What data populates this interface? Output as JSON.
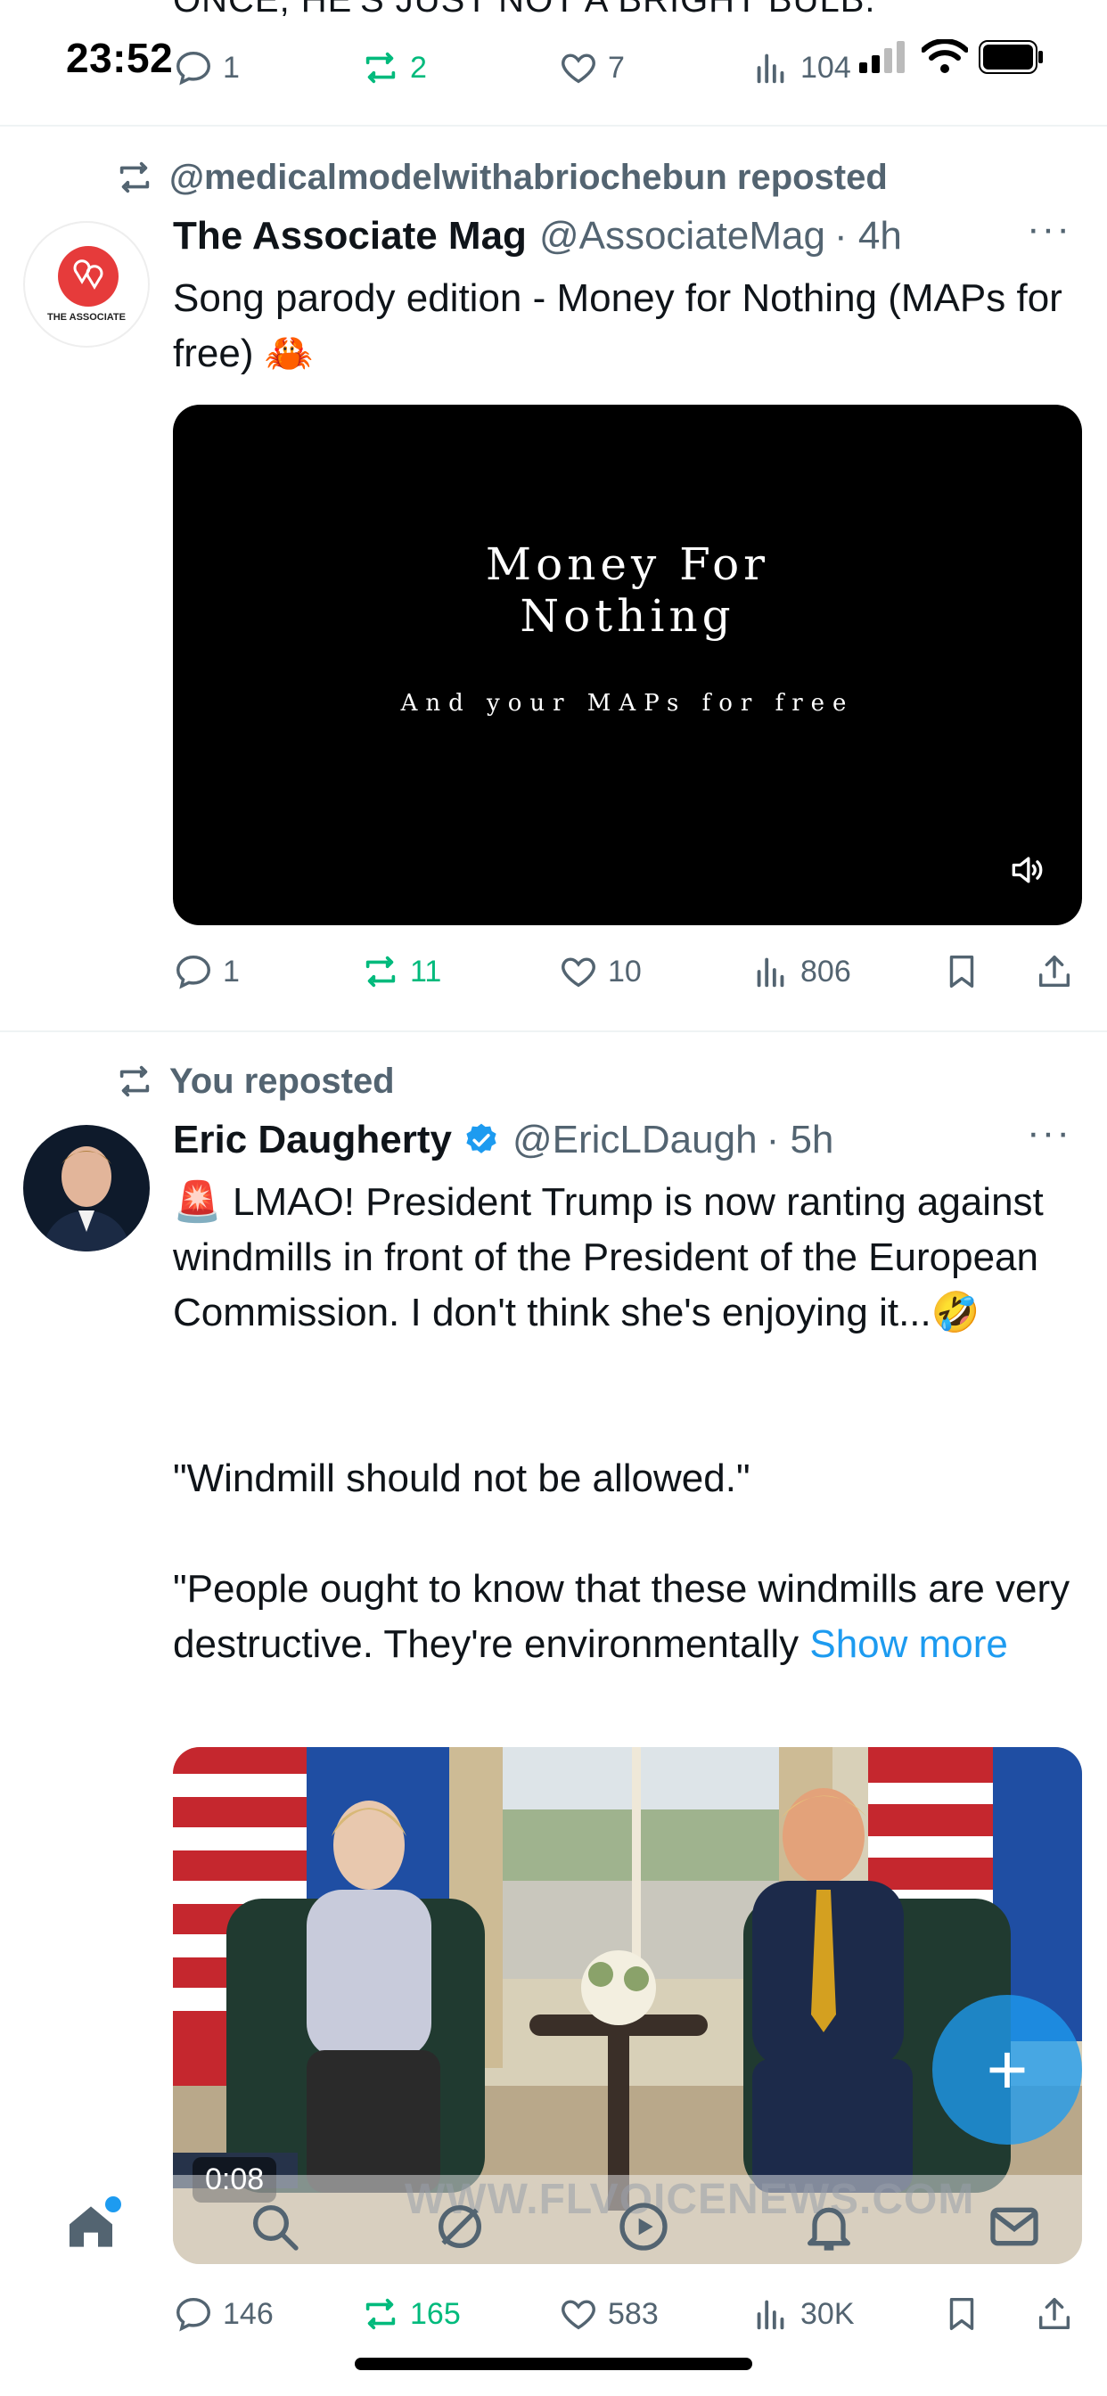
{
  "status": {
    "time": "23:52",
    "signal_text": "104"
  },
  "prev_tweet": {
    "cut_text": "ONCE, HE'S JUST NOT A BRIGHT BULB.",
    "replies": "1",
    "reposts": "2",
    "likes": "7",
    "views": "104"
  },
  "tweet1": {
    "repost_label": "@medicalmodelwithabriochebun reposted",
    "name": "The Associate Mag",
    "handle": "@AssociateMag",
    "time": "· 4h",
    "more": "···",
    "avatar_text": "THE ASSOCIATE",
    "text": "Song parody edition - Money for Nothing (MAPs for free) 🦀",
    "video_title_1": "Money For",
    "video_title_2": "Nothing",
    "video_subtitle": "And your MAPs for free",
    "replies": "1",
    "reposts": "11",
    "likes": "10",
    "views": "806"
  },
  "tweet2": {
    "repost_label": "You reposted",
    "name": "Eric Daugherty",
    "handle": "@EricLDaugh",
    "time": "· 5h",
    "more": "···",
    "text_1": "🚨 LMAO! President Trump is now ranting against windmills in front of the President of the European Commission. I don't think she's enjoying it...🤣",
    "text_2": "\"Windmill should not be allowed.\"",
    "text_3": "\"People ought to know that these windmills are very destructive. They're environmentally ",
    "show_more": "Show more",
    "video_time": "0:08",
    "watermark": "WWW.FLVOICENEWS.COM",
    "replies": "146",
    "reposts": "165",
    "likes": "583",
    "views": "30K"
  },
  "colors": {
    "accent": "#1d9bf0",
    "repost_green": "#00ba7c",
    "secondary_text": "#536471"
  },
  "icons": [
    "reply-icon",
    "repost-icon",
    "like-icon",
    "views-icon",
    "bookmark-icon",
    "share-icon",
    "home-icon",
    "search-icon",
    "grok-icon",
    "video-icon",
    "notifications-icon",
    "messages-icon",
    "compose-plus-icon"
  ]
}
